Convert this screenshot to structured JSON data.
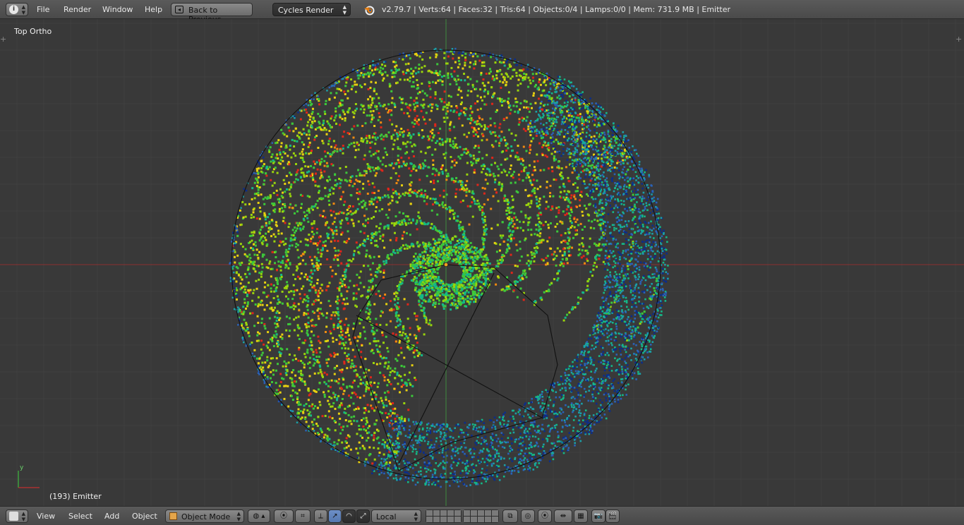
{
  "header": {
    "menus": [
      "File",
      "Render",
      "Window",
      "Help"
    ],
    "back_button": "Back to Previous",
    "render_engine": "Cycles Render",
    "stats": "v2.79.7 | Verts:64 | Faces:32 | Tris:64 | Objects:0/4 | Lamps:0/0 | Mem: 731.9 MB | Emitter"
  },
  "viewport": {
    "view_name": "Top Ortho",
    "object_info": "(193) Emitter",
    "axis_y": "y"
  },
  "footer": {
    "menus": [
      "View",
      "Select",
      "Add",
      "Object"
    ],
    "mode": "Object Mode",
    "orientation": "Local"
  },
  "colors": {
    "grid_x_axis": "#8b2f2f",
    "grid_y_axis": "#3f8a3f",
    "particles_hot": "#e0261a",
    "particles_mid": "#9ad40c",
    "particles_cool": "#1aa0a8",
    "particles_cold": "#0b2d8a"
  }
}
